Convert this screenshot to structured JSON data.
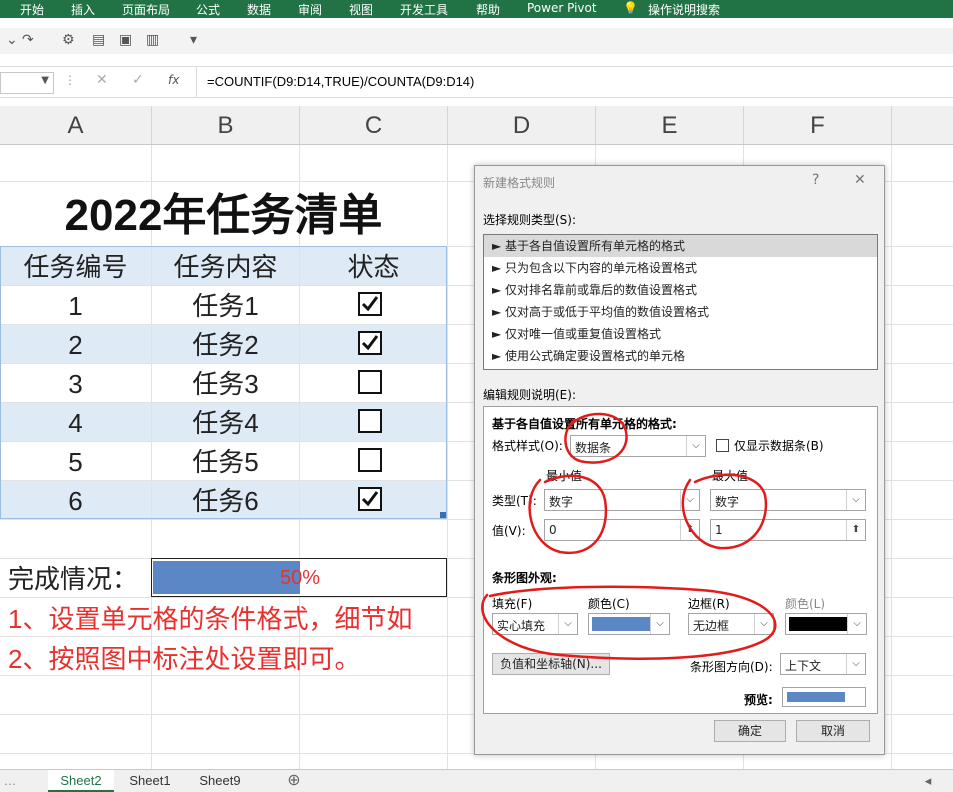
{
  "ribbon": {
    "tabs": [
      "开始",
      "插入",
      "页面布局",
      "公式",
      "数据",
      "审阅",
      "视图",
      "开发工具",
      "帮助",
      "Power Pivot",
      "操作说明搜索"
    ]
  },
  "formula_bar": {
    "formula": "=COUNTIF(D9:D14,TRUE)/COUNTA(D9:D14)",
    "fx": "fx",
    "cancel": "✕",
    "enter": "✓"
  },
  "columns": [
    "A",
    "B",
    "C",
    "D",
    "E",
    "F"
  ],
  "sheet": {
    "title": "2022年任务清单",
    "headers": [
      "任务编号",
      "任务内容",
      "状态"
    ],
    "rows": [
      {
        "num": "1",
        "task": "任务1",
        "done": true
      },
      {
        "num": "2",
        "task": "任务2",
        "done": true
      },
      {
        "num": "3",
        "task": "任务3",
        "done": false
      },
      {
        "num": "4",
        "task": "任务4",
        "done": false
      },
      {
        "num": "5",
        "task": "任务5",
        "done": false
      },
      {
        "num": "6",
        "task": "任务6",
        "done": true
      }
    ],
    "progress_label": "完成情况：",
    "progress_value": "50%",
    "progress_fraction": 0.5,
    "note1": "1、设置单元格的条件格式，细节如",
    "note2": "2、按照图中标注处设置即可。"
  },
  "dialog": {
    "title": "新建格式规则",
    "help": "?",
    "close": "✕",
    "select_rule_type": "选择规则类型(S):",
    "rules": [
      "► 基于各自值设置所有单元格的格式",
      "► 只为包含以下内容的单元格设置格式",
      "► 仅对排名靠前或靠后的数值设置格式",
      "► 仅对高于或低于平均值的数值设置格式",
      "► 仅对唯一值或重复值设置格式",
      "► 使用公式确定要设置格式的单元格"
    ],
    "edit_desc": "编辑规则说明(E):",
    "section_title": "基于各自值设置所有单元格的格式:",
    "format_style_label": "格式样式(O):",
    "format_style_value": "数据条",
    "show_bar_only": "仅显示数据条(B)",
    "min_label": "最小值",
    "max_label": "最大值",
    "type_label": "类型(T):",
    "value_label": "值(V):",
    "min_type": "数字",
    "max_type": "数字",
    "min_value": "0",
    "max_value": "1",
    "bar_appearance": "条形图外观:",
    "fill_label": "填充(F)",
    "color_label": "颜色(C)",
    "border_label": "边框(R)",
    "border_color_label": "颜色(L)",
    "fill_value": "实心填充",
    "border_value": "无边框",
    "fill_color": "#5b87c5",
    "border_color": "#000000",
    "neg_axis_button": "负值和坐标轴(N)...",
    "direction_label": "条形图方向(D):",
    "direction_value": "上下文",
    "preview_label": "预览:",
    "ok": "确定",
    "cancel": "取消"
  },
  "sheet_tabs": [
    "Sheet2",
    "Sheet1",
    "Sheet9"
  ],
  "add_sheet": "⊕"
}
